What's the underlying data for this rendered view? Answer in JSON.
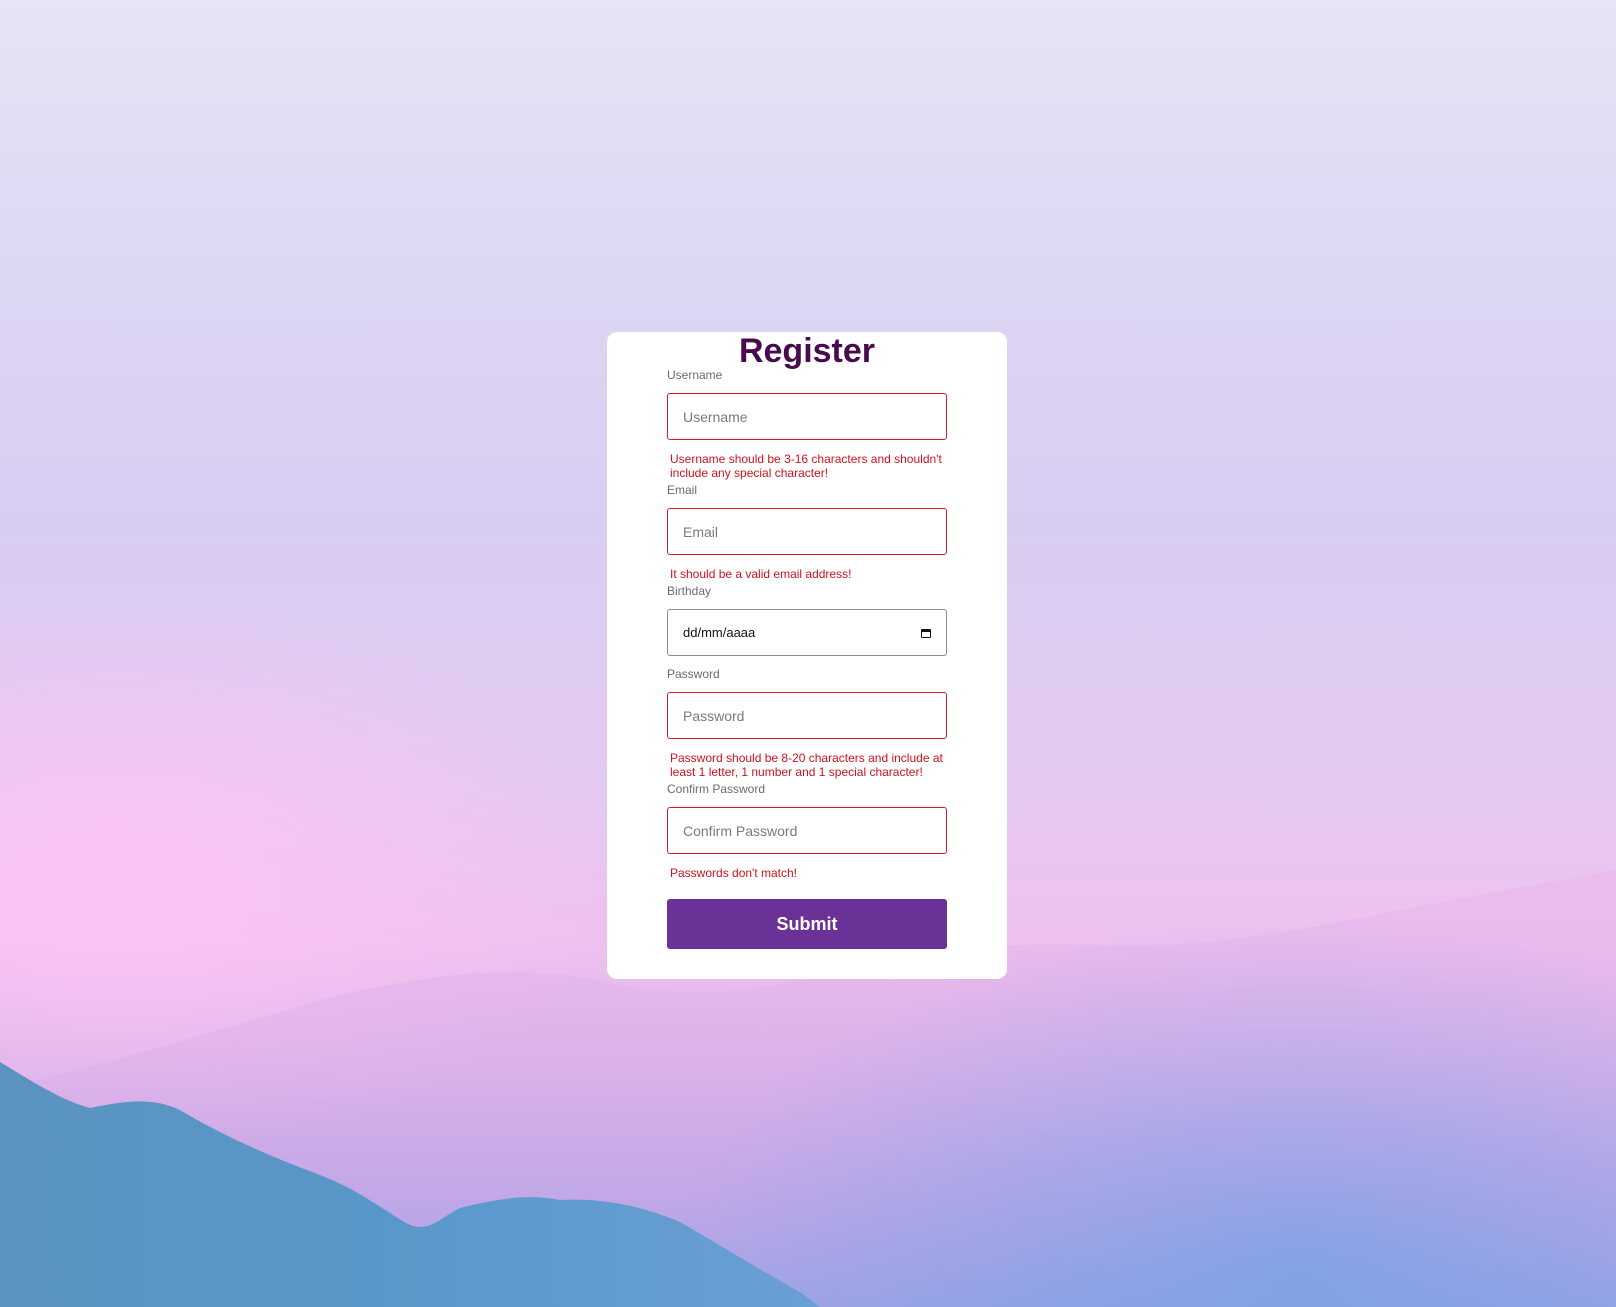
{
  "form": {
    "title": "Register",
    "fields": [
      {
        "label": "Username",
        "placeholder": "Username",
        "value": "",
        "error": "Username should be 3-16 characters and shouldn't include any special character!"
      },
      {
        "label": "Email",
        "placeholder": "Email",
        "value": "",
        "error": "It should be a valid email address!"
      },
      {
        "label": "Birthday",
        "placeholder": "dd/mm/aaaa",
        "value": "",
        "icon": "calendar-icon"
      },
      {
        "label": "Password",
        "placeholder": "Password",
        "value": "",
        "error": "Password should be 8-20 characters and include at least 1 letter, 1 number and 1 special character!"
      },
      {
        "label": "Confirm Password",
        "placeholder": "Confirm Password",
        "value": "",
        "error": "Passwords don't match!"
      }
    ],
    "submit_label": "Submit"
  },
  "colors": {
    "title": "#4a0b4e",
    "error": "#d0121c",
    "invalid_border": "#d21f2b",
    "submit_bg": "#6a3196",
    "card_bg": "#ffffff"
  }
}
